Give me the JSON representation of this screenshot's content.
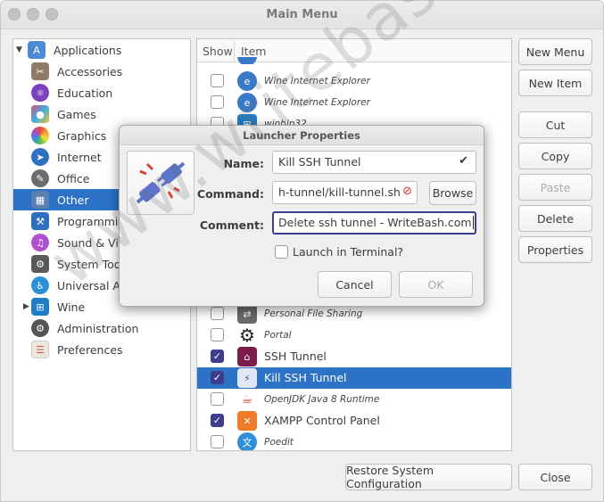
{
  "window": {
    "title": "Main Menu"
  },
  "categories": [
    {
      "label": "Applications",
      "icon": "applications-icon",
      "color": "#4a8ad6"
    },
    {
      "label": "Accessories",
      "icon": "accessories-icon",
      "color": "#8d7b63"
    },
    {
      "label": "Education",
      "icon": "education-icon",
      "color": "#7b3fc1"
    },
    {
      "label": "Games",
      "icon": "games-icon",
      "color": "#e04a7a"
    },
    {
      "label": "Graphics",
      "icon": "graphics-icon",
      "color": "#f0a030"
    },
    {
      "label": "Internet",
      "icon": "internet-icon",
      "color": "#2d6fc1"
    },
    {
      "label": "Office",
      "icon": "office-icon",
      "color": "#6c6c6c"
    },
    {
      "label": "Other",
      "icon": "other-icon",
      "color": "#5a7fb0"
    },
    {
      "label": "Programming",
      "icon": "programming-icon",
      "color": "#2d6fc1"
    },
    {
      "label": "Sound & Video",
      "icon": "sound-video-icon",
      "color": "#b04fcf"
    },
    {
      "label": "System Tools",
      "icon": "system-tools-icon",
      "color": "#5a5a5a"
    },
    {
      "label": "Universal Access",
      "icon": "universal-access-icon",
      "color": "#2a8fd8"
    },
    {
      "label": "Wine",
      "icon": "wine-icon",
      "color": "#1e7ec8"
    },
    {
      "label": "Administration",
      "icon": "administration-icon",
      "color": "#555555"
    },
    {
      "label": "Preferences",
      "icon": "preferences-icon",
      "color": "#cc5544"
    }
  ],
  "columns": {
    "show": "Show",
    "item": "Item"
  },
  "items": [
    {
      "name": "Wine Internet Explorer",
      "checked": false,
      "hidden": true,
      "color": "#3a78c8"
    },
    {
      "name": "Wine Internet Explorer",
      "checked": false,
      "hidden": true,
      "color": "#3a78c8"
    },
    {
      "name": "Wine Internet Explorer",
      "checked": false,
      "hidden": true,
      "color": "#3a78c8"
    },
    {
      "name": "winhlp32",
      "checked": false,
      "hidden": true,
      "color": "#1e7ec8"
    },
    {
      "name": "Personal File Sharing",
      "checked": false,
      "hidden": true,
      "color": "#6a6a6a"
    },
    {
      "name": "Portal",
      "checked": false,
      "hidden": true,
      "color": "#222222"
    },
    {
      "name": "SSH Tunnel",
      "checked": true,
      "hidden": false,
      "color": "#7b1c4c"
    },
    {
      "name": "Kill SSH Tunnel",
      "checked": true,
      "hidden": false,
      "color": "#3e5fb5"
    },
    {
      "name": "OpenJDK Java 8 Runtime",
      "checked": false,
      "hidden": true,
      "color": "#d84f2a"
    },
    {
      "name": "XAMPP Control Panel",
      "checked": true,
      "hidden": false,
      "color": "#f07a2a"
    },
    {
      "name": "Poedit",
      "checked": false,
      "hidden": true,
      "color": "#2f8ed8"
    }
  ],
  "buttons": {
    "new_menu": "New Menu",
    "new_item": "New Item",
    "cut": "Cut",
    "copy": "Copy",
    "paste": "Paste",
    "delete": "Delete",
    "properties": "Properties",
    "restore": "Restore System Configuration",
    "close": "Close"
  },
  "dialog": {
    "title": "Launcher Properties",
    "name_label": "Name:",
    "name_value": "Kill SSH Tunnel",
    "command_label": "Command:",
    "command_value": "h-tunnel/kill-tunnel.sh",
    "browse": "Browse",
    "comment_label": "Comment:",
    "comment_value": "Delete ssh tunnel - WriteBash.com",
    "launch_terminal": "Launch in Terminal?",
    "cancel": "Cancel",
    "ok": "OK"
  },
  "watermark": "www.writebash.com",
  "colors": {
    "selection": "#2c72c7",
    "checkbox": "#3e3d8e"
  }
}
